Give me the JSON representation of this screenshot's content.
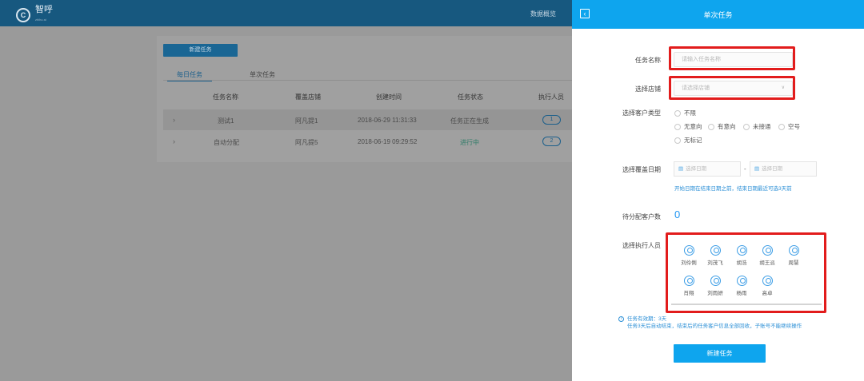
{
  "app": {
    "logo_letter": "C",
    "name": "智呼",
    "sub": "zhihu ai"
  },
  "topnav": {
    "overview": "数据概览"
  },
  "bg": {
    "new_task_button": "新建任务",
    "tabs": [
      "每日任务",
      "单次任务"
    ],
    "columns": [
      "任务名称",
      "覆盖店铺",
      "创建时间",
      "任务状态",
      "执行人员"
    ],
    "rows": [
      {
        "name": "测试1",
        "store": "阿凡提1",
        "created": "2018-06-29 11:31:33",
        "status": "任务正在生成",
        "staff": "1"
      },
      {
        "name": "自动分配",
        "store": "阿凡提5",
        "created": "2018-06-19 09:29:52",
        "status": "进行中",
        "staff": "2"
      }
    ]
  },
  "panel": {
    "title": "单次任务",
    "back_icon": "chevron-left-icon",
    "task_name_label": "任务名称",
    "task_name_placeholder": "请输入任务名称",
    "store_label": "选择店铺",
    "store_placeholder": "请选择店铺",
    "customer_type_label": "选择客户类型",
    "customer_types": [
      "不限",
      "无意向",
      "有意向",
      "未接通",
      "空号",
      "无标记"
    ],
    "date_label": "选择覆盖日期",
    "date_start_placeholder": "选择日期",
    "date_separator": "-",
    "date_end_placeholder": "选择日期",
    "date_hint": "开始日期在结束日期之前，结束日期最近可选3天前",
    "pending_label": "待分配客户数",
    "pending_count": "0",
    "staff_label": "选择执行人员",
    "staff": [
      "刘伶俐",
      "刘茂飞",
      "胡浩",
      "胡王派",
      "周慧",
      "肖翔",
      "刘雨妍",
      "杨雨",
      "高卓"
    ],
    "note_line1": "任务有效期：3天",
    "note_line2": "任务3天后自动结束，结束后的任务客户信息全部回收，子账号不能继续操作",
    "submit_label": "新建任务"
  },
  "colors": {
    "header_bg": "#17587f",
    "panel_accent": "#0ea5ee",
    "highlight_box": "#e21c1c"
  }
}
